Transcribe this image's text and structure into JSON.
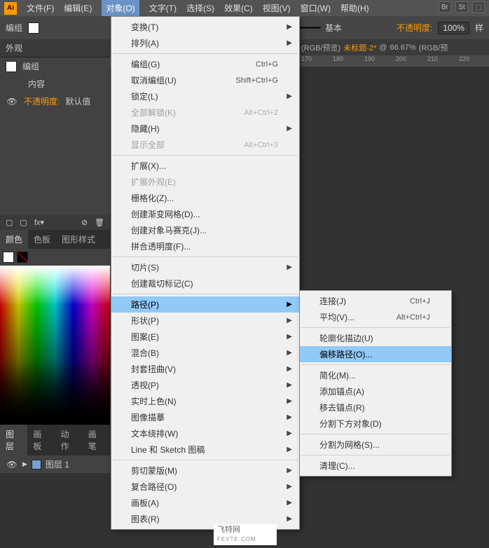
{
  "app_icon_text": "Ai",
  "menubar": [
    "文件(F)",
    "编辑(E)",
    "对象(O)",
    "文字(T)",
    "选择(S)",
    "效果(C)",
    "视图(V)",
    "窗口(W)",
    "帮助(H)"
  ],
  "active_menu_index": 2,
  "right_icons": [
    "Br",
    "St",
    "⬚"
  ],
  "control": {
    "label": "编组",
    "basic_label": "基本",
    "opacity_label": "不透明度:",
    "opacity_value": "100%",
    "style_label": "样"
  },
  "doc_tab": {
    "mode": "(RGB/预览)",
    "doc_name": "未标题-2*",
    "zoom": "66.67%",
    "mode2": "(RGB/预"
  },
  "ruler_ticks": [
    "170",
    "180",
    "190",
    "200",
    "210",
    "220"
  ],
  "appearance": {
    "panel_title": "外观",
    "group_label": "编组",
    "content_label": "内容",
    "opacity_label": "不透明度:",
    "opacity_default": "默认值",
    "fx_label": "fx▾"
  },
  "color_tabs": [
    "颜色",
    "色板",
    "图形样式"
  ],
  "layer_tabs": [
    "图层",
    "画板",
    "动作",
    "画笔"
  ],
  "layer_name": "图层 1",
  "object_menu": [
    {
      "label": "变换(T)",
      "sub": true
    },
    {
      "label": "排列(A)",
      "sub": true
    },
    {
      "sep": true
    },
    {
      "label": "编组(G)",
      "shortcut": "Ctrl+G"
    },
    {
      "label": "取消编组(U)",
      "shortcut": "Shift+Ctrl+G"
    },
    {
      "label": "锁定(L)",
      "sub": true
    },
    {
      "label": "全部解锁(K)",
      "shortcut": "Alt+Ctrl+2",
      "disabled": true
    },
    {
      "label": "隐藏(H)",
      "sub": true
    },
    {
      "label": "显示全部",
      "shortcut": "Alt+Ctrl+3",
      "disabled": true
    },
    {
      "sep": true
    },
    {
      "label": "扩展(X)..."
    },
    {
      "label": "扩展外观(E)",
      "disabled": true
    },
    {
      "label": "栅格化(Z)..."
    },
    {
      "label": "创建渐变网格(D)..."
    },
    {
      "label": "创建对象马赛克(J)..."
    },
    {
      "label": "拼合透明度(F)..."
    },
    {
      "sep": true
    },
    {
      "label": "切片(S)",
      "sub": true
    },
    {
      "label": "创建裁切标记(C)"
    },
    {
      "sep": true
    },
    {
      "label": "路径(P)",
      "sub": true,
      "hl": true
    },
    {
      "label": "形状(P)",
      "sub": true
    },
    {
      "label": "图案(E)",
      "sub": true
    },
    {
      "label": "混合(B)",
      "sub": true
    },
    {
      "label": "封套扭曲(V)",
      "sub": true
    },
    {
      "label": "透视(P)",
      "sub": true
    },
    {
      "label": "实时上色(N)",
      "sub": true
    },
    {
      "label": "图像描摹",
      "sub": true
    },
    {
      "label": "文本绕排(W)",
      "sub": true
    },
    {
      "label": "Line 和 Sketch 图稿",
      "sub": true
    },
    {
      "sep": true
    },
    {
      "label": "剪切蒙版(M)",
      "sub": true
    },
    {
      "label": "复合路径(O)",
      "sub": true
    },
    {
      "label": "画板(A)",
      "sub": true
    },
    {
      "label": "图表(R)",
      "sub": true
    }
  ],
  "path_submenu": [
    {
      "label": "连接(J)",
      "shortcut": "Ctrl+J"
    },
    {
      "label": "平均(V)...",
      "shortcut": "Alt+Ctrl+J"
    },
    {
      "sep": true
    },
    {
      "label": "轮廓化描边(U)"
    },
    {
      "label": "偏移路径(O)...",
      "hl": true
    },
    {
      "sep": true
    },
    {
      "label": "简化(M)..."
    },
    {
      "label": "添加锚点(A)"
    },
    {
      "label": "移去锚点(R)"
    },
    {
      "label": "分割下方对象(D)"
    },
    {
      "sep": true
    },
    {
      "label": "分割为网格(S)..."
    },
    {
      "sep": true
    },
    {
      "label": "清理(C)..."
    }
  ],
  "caption": {
    "line1": "飞特网",
    "line2": "FEVTE.COM"
  }
}
